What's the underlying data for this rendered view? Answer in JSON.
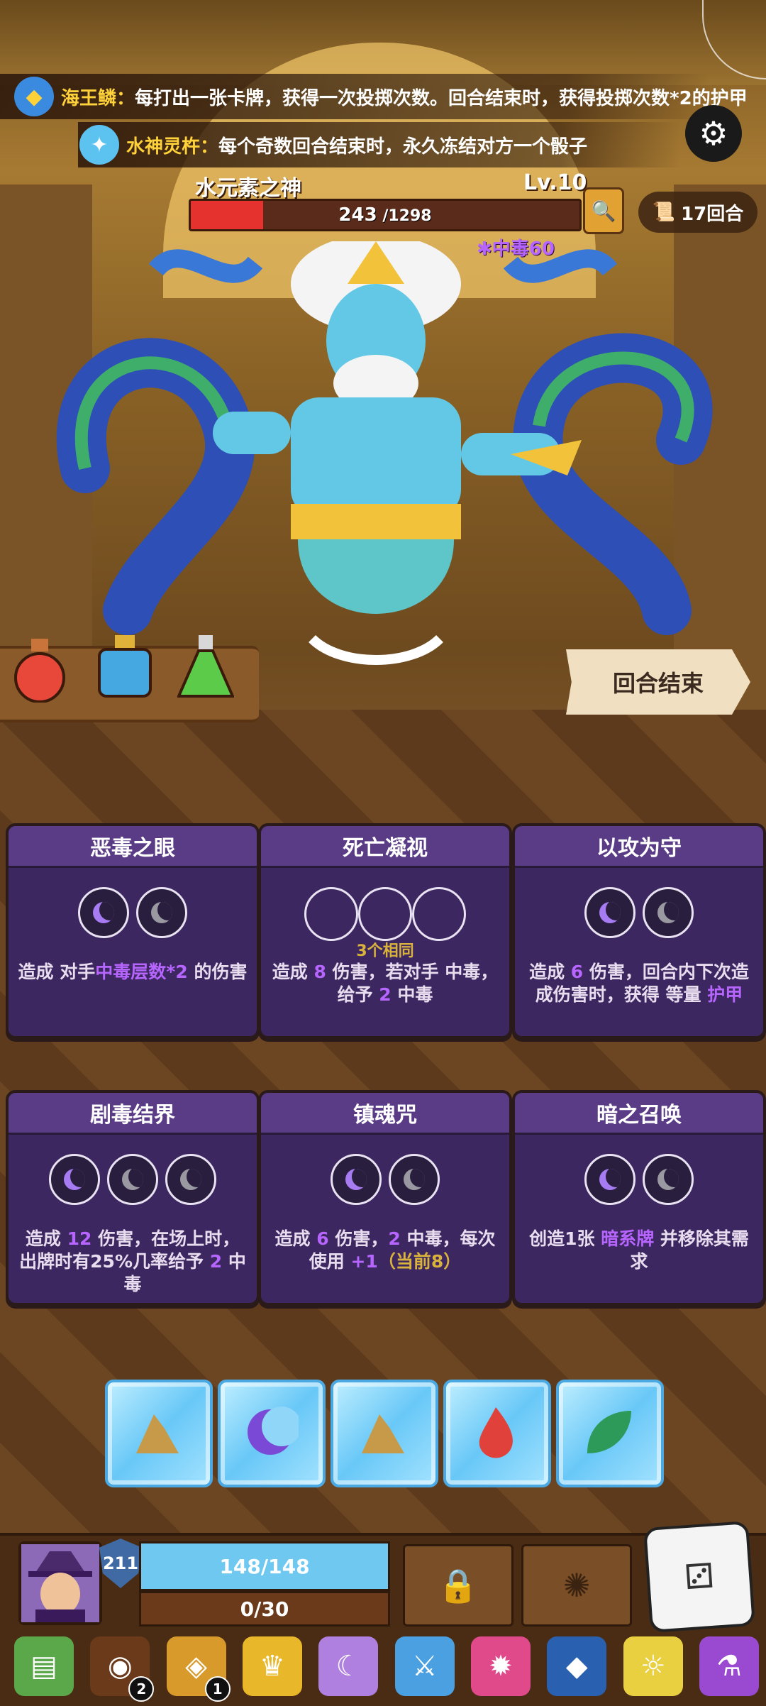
{
  "relics": [
    {
      "icon": "sea-king-scale-icon",
      "name": "海王鳞",
      "sep": "：",
      "desc": "每打出一张卡牌，获得一次投掷次数。回合结束时，获得投掷次数*2的护甲"
    },
    {
      "icon": "water-god-chalice-icon",
      "name": "水神灵杵",
      "sep": "：",
      "desc": "每个奇数回合结束时，永久冻结对方一个骰子"
    }
  ],
  "boss": {
    "name": "水元素之神",
    "level": "Lv.10",
    "hp_current": "243",
    "hp_max": " /1298",
    "hp_fraction": 0.187,
    "status": "中毒60",
    "status_icon": "poison-icon"
  },
  "round": "17回合",
  "end_turn": "回合结束",
  "potions": [
    {
      "color": "#e8483a"
    },
    {
      "color": "#46a8e0"
    },
    {
      "color": "#5ccb4a"
    }
  ],
  "cards": [
    {
      "title": "恶毒之眼",
      "slots": [
        "purple",
        "gray"
      ],
      "desc_pre": "造成 对手",
      "desc_hl": "中毒层数*2",
      "desc_post": " 的伤害"
    },
    {
      "title": "死亡凝视",
      "slots": [
        "empty",
        "empty",
        "empty"
      ],
      "same": "3个相同",
      "desc_pre": "造成 ",
      "desc_hl": "8",
      "desc_post": " 伤害，若对手 中毒，给予 ",
      "desc_hl2": "2",
      "desc_post2": " 中毒"
    },
    {
      "title": "以攻为守",
      "slots": [
        "purple",
        "gray"
      ],
      "desc_pre": "造成 ",
      "desc_hl": "6",
      "desc_post": " 伤害，回合内下次造成伤害时，获得 等量 ",
      "desc_hl2": "护甲",
      "desc_post2": ""
    },
    {
      "title": "剧毒结界",
      "slots": [
        "purple",
        "gray",
        "gray"
      ],
      "desc_pre": "造成 ",
      "desc_hl": "12",
      "desc_post": " 伤害，在场上时，出牌时有25%几率给予 ",
      "desc_hl2": "2",
      "desc_post2": " 中毒"
    },
    {
      "title": "镇魂咒",
      "slots": [
        "purple",
        "gray"
      ],
      "desc_pre": "造成 ",
      "desc_hl": "6",
      "desc_post": " 伤害，",
      "desc_hl2": "2",
      "desc_post2": " 中毒，每次使用 ",
      "desc_hl3": "+1",
      "desc_yl": "（当前8）"
    },
    {
      "title": "暗之召唤",
      "slots": [
        "purple",
        "gray"
      ],
      "desc_pre": "创造1张 ",
      "desc_hl": "暗系牌",
      "desc_post": " 并移除其需求"
    }
  ],
  "dice": [
    {
      "symbol": "earth-icon",
      "color": "#c79a4a"
    },
    {
      "symbol": "dark-moon-icon",
      "color": "#7a4ad6"
    },
    {
      "symbol": "earth-icon",
      "color": "#c79a4a"
    },
    {
      "symbol": "fire-icon",
      "color": "#e0413a"
    },
    {
      "symbol": "wind-leaf-icon",
      "color": "#2e9a5a"
    }
  ],
  "player": {
    "armor": "211",
    "hp": "148/148",
    "exp": "0/30"
  },
  "inventory": [
    {
      "icon": "spellbook-icon",
      "badge": ""
    },
    {
      "icon": "button-token-icon",
      "badge": "2"
    },
    {
      "icon": "coin-bag-icon",
      "badge": "1"
    },
    {
      "icon": "crown-icon",
      "badge": ""
    },
    {
      "icon": "moon-orb-icon",
      "badge": ""
    },
    {
      "icon": "crystal-sword-icon",
      "badge": ""
    },
    {
      "icon": "pink-fire-orb-icon",
      "badge": ""
    },
    {
      "icon": "dragon-helm-icon",
      "badge": ""
    },
    {
      "icon": "lantern-bell-icon",
      "badge": ""
    },
    {
      "icon": "purple-potion-icon",
      "badge": ""
    }
  ]
}
